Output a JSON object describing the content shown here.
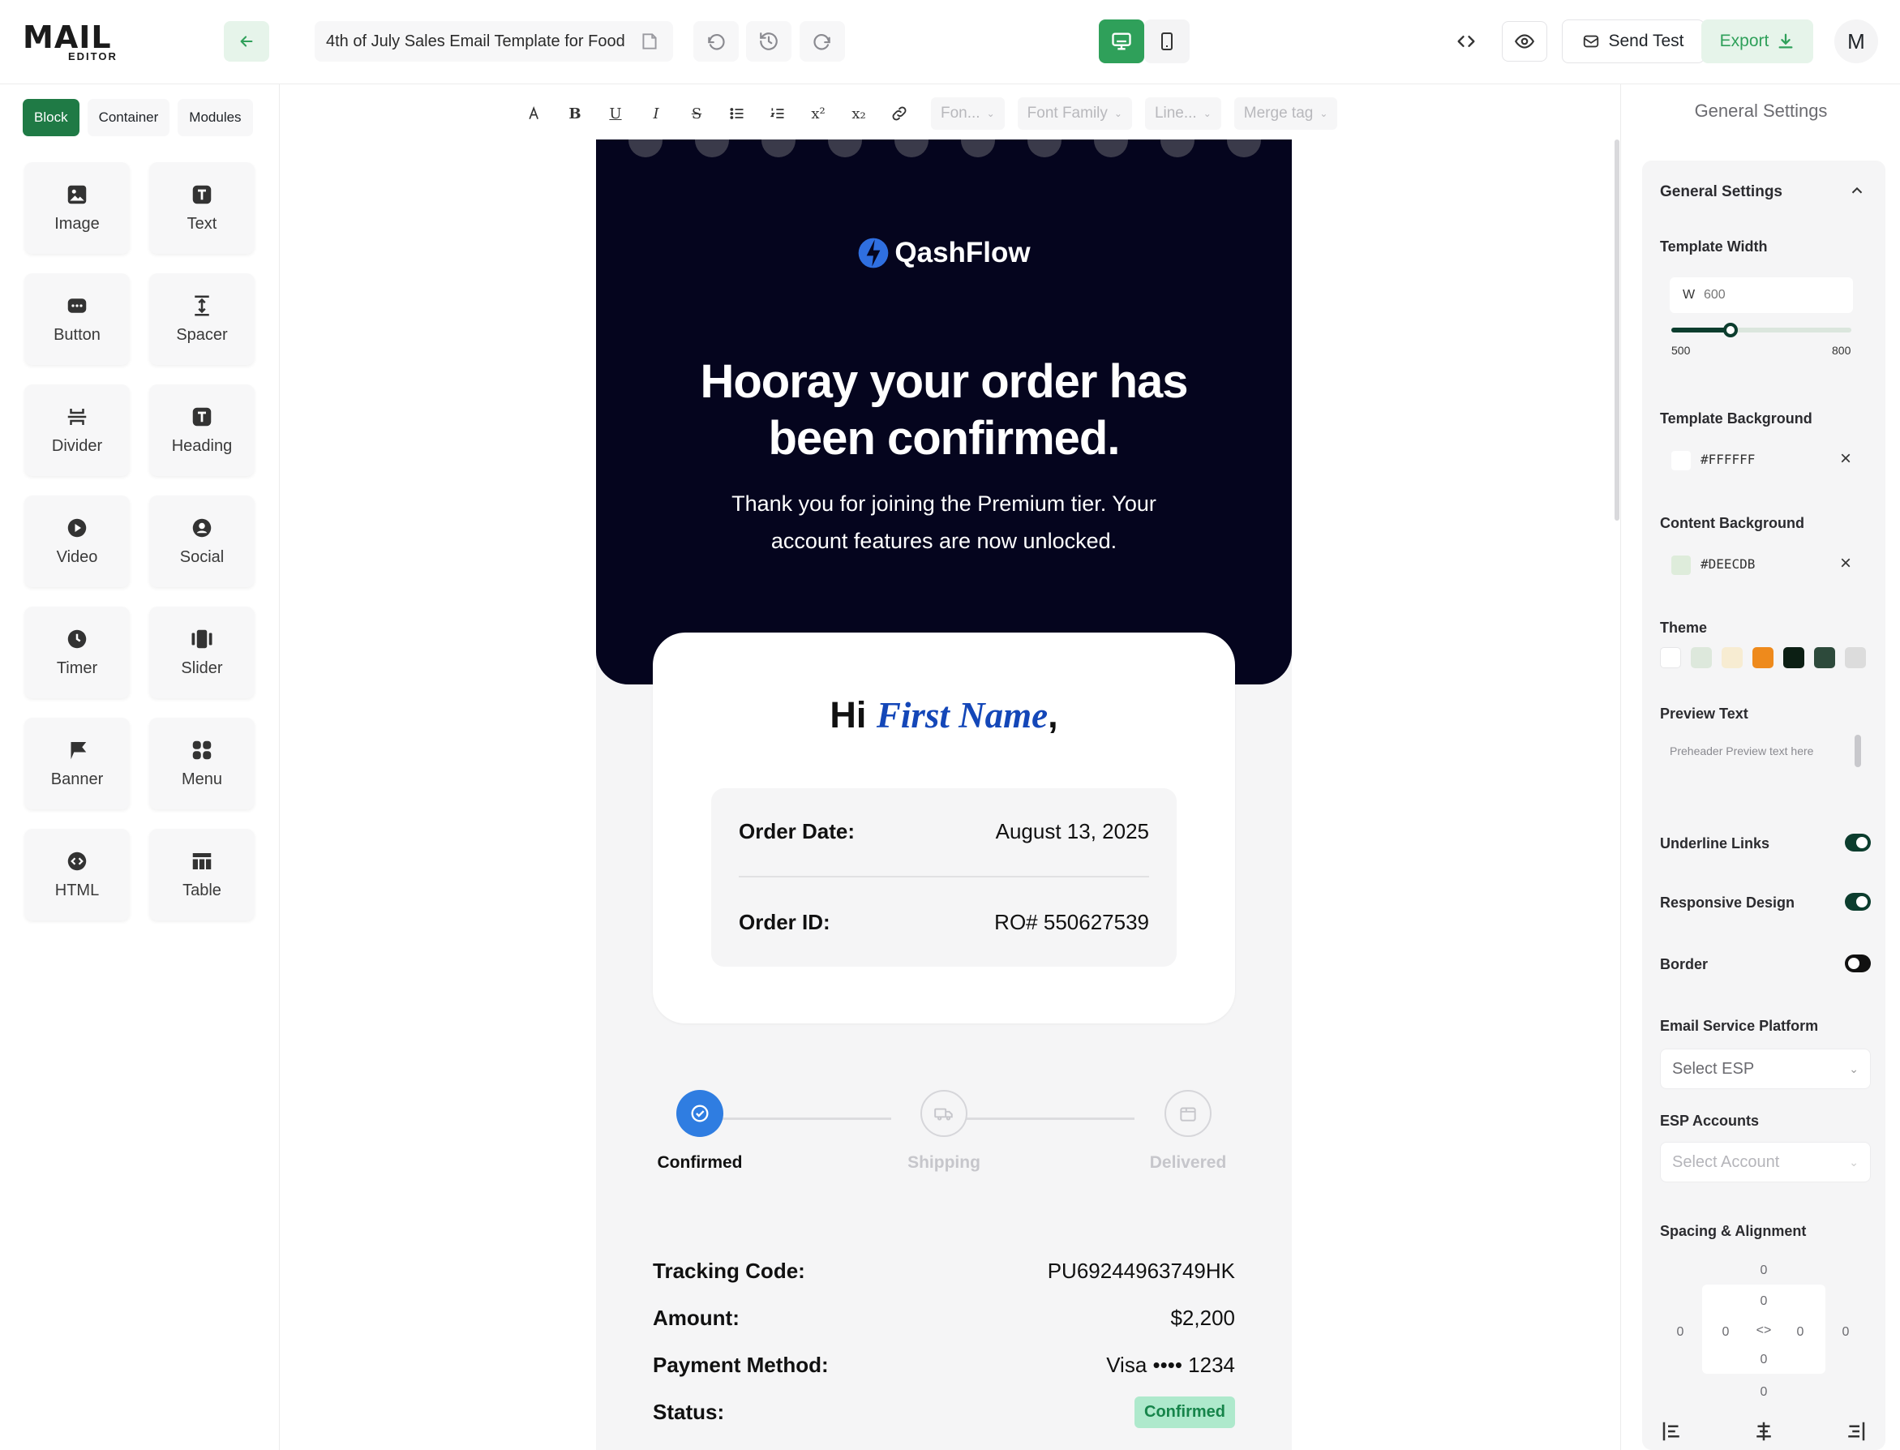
{
  "app": {
    "logo_main": "MAIL",
    "logo_sub": "EDITOR",
    "template_title": "4th of July Sales Email Template for Food",
    "send_test_label": "Send Test",
    "export_label": "Export",
    "avatar_initial": "M"
  },
  "left": {
    "tabs": [
      "Block",
      "Container",
      "Modules"
    ],
    "blocks": [
      "Image",
      "Text",
      "Button",
      "Spacer",
      "Divider",
      "Heading",
      "Video",
      "Social",
      "Timer",
      "Slider",
      "Banner",
      "Menu",
      "HTML",
      "Table"
    ]
  },
  "toolbar": {
    "font_size_placeholder": "Fon...",
    "font_family_placeholder": "Font Family",
    "line_height_placeholder": "Line...",
    "merge_tag_label": "Merge tag"
  },
  "email": {
    "brand": "QashFlow",
    "headline_line1": "Hooray your order has",
    "headline_line2": "been confirmed.",
    "subtext": "Thank you for joining the Premium tier. Your account features are now unlocked.",
    "greeting": "Hi",
    "first_name": "First Name",
    "order_date_label": "Order Date:",
    "order_date_value": "August 13, 2025",
    "order_id_label": "Order ID:",
    "order_id_value": "RO# 550627539",
    "steps": [
      "Confirmed",
      "Shipping",
      "Delivered"
    ],
    "tracking_label": "Tracking Code:",
    "tracking_value": "PU69244963749HK",
    "amount_label": "Amount:",
    "amount_value": "$2,200",
    "payment_label": "Payment Method:",
    "payment_value": "Visa •••• 1234",
    "status_label": "Status:",
    "status_value": "Confirmed"
  },
  "settings": {
    "header": "General Settings",
    "section_title": "General Settings",
    "template_width_label": "Template Width",
    "width_prefix": "W",
    "width_value": "600",
    "slider_min": "500",
    "slider_max": "800",
    "slider_fraction": 0.33,
    "template_bg_label": "Template Background",
    "template_bg_value": "#FFFFFF",
    "content_bg_label": "Content Background",
    "content_bg_value": "#DEECDB",
    "theme_label": "Theme",
    "theme_colors": [
      "#ffffff",
      "#dde8dc",
      "#f7ecd2",
      "#ee8a1c",
      "#0c1f14",
      "#2d4a3b",
      "#dcdcdc"
    ],
    "preview_text_label": "Preview Text",
    "preview_text_placeholder": "Preheader Preview text here",
    "underline_links_label": "Underline Links",
    "responsive_design_label": "Responsive Design",
    "border_label": "Border",
    "esp_label": "Email Service Platform",
    "esp_placeholder": "Select ESP",
    "esp_accounts_label": "ESP Accounts",
    "esp_accounts_placeholder": "Select Account",
    "spacing_label": "Spacing & Alignment",
    "spacing_values": [
      "0",
      "0",
      "0",
      "0",
      "0",
      "0",
      "0",
      "0",
      "0"
    ]
  }
}
